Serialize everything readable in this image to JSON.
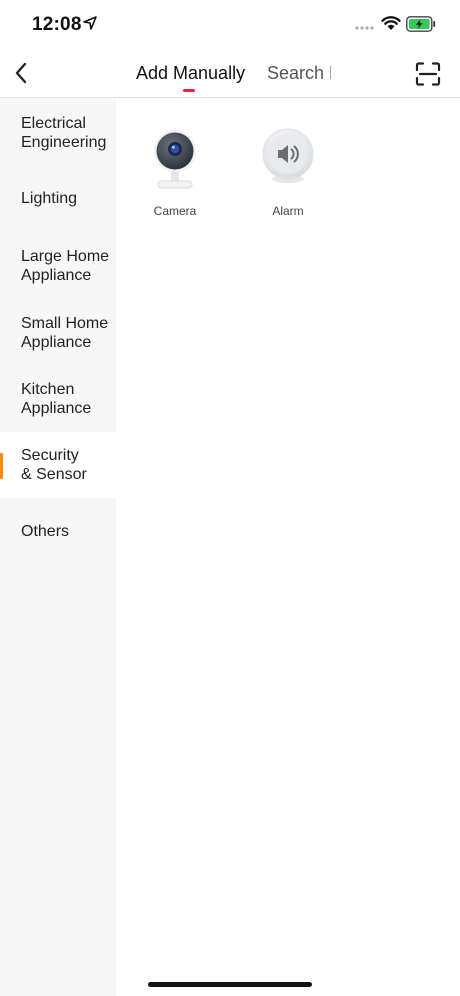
{
  "status": {
    "time": "12:08"
  },
  "nav": {
    "tabs": [
      {
        "label": "Add Manually",
        "active": true
      },
      {
        "label": "Search Devices",
        "active": false
      }
    ]
  },
  "sidebar": {
    "items": [
      {
        "label": "Electrical\nEngineering",
        "active": false
      },
      {
        "label": "Lighting",
        "active": false
      },
      {
        "label": "Large Home\nAppliance",
        "active": false
      },
      {
        "label": "Small Home\nAppliance",
        "active": false
      },
      {
        "label": "Kitchen\nAppliance",
        "active": false
      },
      {
        "label": "Security\n& Sensor",
        "active": true
      },
      {
        "label": "Others",
        "active": false
      }
    ]
  },
  "devices": [
    {
      "name": "Camera",
      "icon": "camera-icon"
    },
    {
      "name": "Alarm",
      "icon": "alarm-speaker-icon"
    }
  ],
  "colors": {
    "accent": "#e8273f",
    "active_marker": "#ff8c00",
    "sidebar_bg": "#f7f7f7"
  }
}
